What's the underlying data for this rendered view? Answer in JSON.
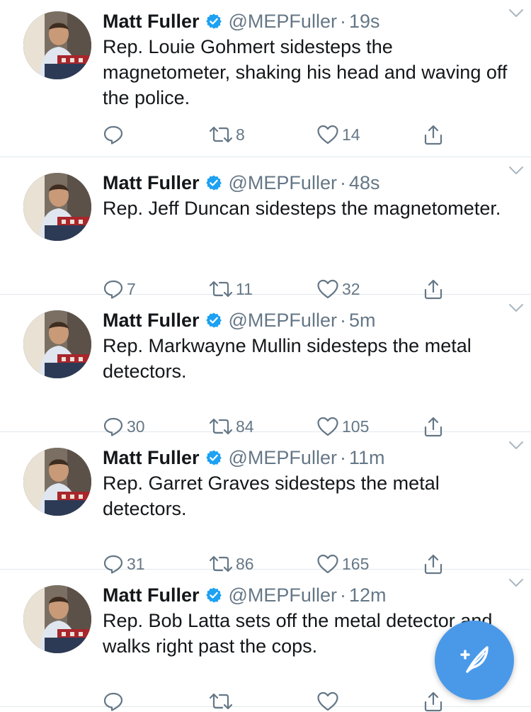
{
  "colors": {
    "accent": "#1da1f2",
    "compose": "#4a99e9",
    "muted": "#657786",
    "text": "#14171a"
  },
  "tweets": [
    {
      "name": "Matt Fuller",
      "handle": "@MEPFuller",
      "time": "19s",
      "text": "Rep. Louie Gohmert sidesteps the magnetometer, shaking his head and waving off the police.",
      "replies": "",
      "retweets": "8",
      "likes": "14"
    },
    {
      "name": "Matt Fuller",
      "handle": "@MEPFuller",
      "time": "48s",
      "text": "Rep. Jeff Duncan sidesteps the magnetometer.",
      "replies": "7",
      "retweets": "11",
      "likes": "32"
    },
    {
      "name": "Matt Fuller",
      "handle": "@MEPFuller",
      "time": "5m",
      "text": "Rep. Markwayne Mullin sidesteps the metal detectors.",
      "replies": "30",
      "retweets": "84",
      "likes": "105"
    },
    {
      "name": "Matt Fuller",
      "handle": "@MEPFuller",
      "time": "11m",
      "text": "Rep. Garret Graves sidesteps the metal detectors.",
      "replies": "31",
      "retweets": "86",
      "likes": "165"
    },
    {
      "name": "Matt Fuller",
      "handle": "@MEPFuller",
      "time": "12m",
      "text": "Rep. Bob Latta sets off the metal detector and walks right past the cops.",
      "replies": "",
      "retweets": "",
      "likes": ""
    }
  ],
  "icons": {
    "verified": "verified-badge-icon",
    "caret": "chevron-down-icon",
    "reply": "reply-icon",
    "retweet": "retweet-icon",
    "like": "heart-icon",
    "share": "share-icon",
    "compose": "compose-tweet-icon"
  }
}
